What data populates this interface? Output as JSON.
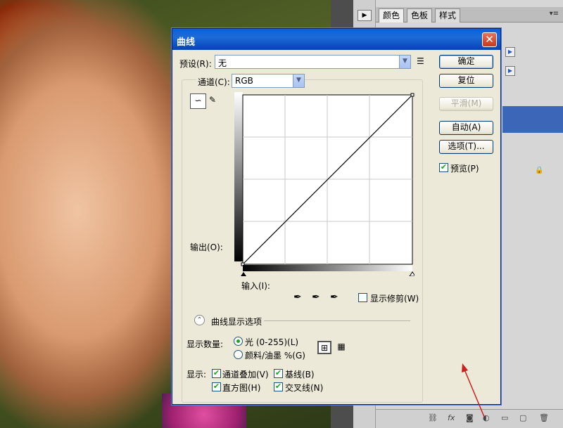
{
  "panel": {
    "tabs": [
      "颜色",
      "色板",
      "样式"
    ],
    "tab_menu_icon": "panel-menu-icon",
    "bottom_icons": [
      "link-icon",
      "fx-icon",
      "mask-icon",
      "adjustment-icon",
      "folder-icon",
      "new-layer-icon",
      "trash-icon"
    ],
    "fx_label": "fx"
  },
  "dialog": {
    "title": "曲线",
    "close_label": "✕",
    "preset_label": "预设(R):",
    "preset_value": "无",
    "channel_label": "通道(C):",
    "channel_value": "RGB",
    "output_label": "输出(O):",
    "input_label": "输入(I):",
    "show_clipping_label": "显示修剪(W)",
    "curve_options_label": "曲线显示选项",
    "show_amount_label": "显示数量:",
    "light_option": "光 (0-255)(L)",
    "pigment_option": "颜料/油墨 %(G)",
    "show_label": "显示:",
    "channel_overlay": "通道叠加(V)",
    "baseline": "基线(B)",
    "histogram": "直方图(H)",
    "intersection": "交叉线(N)",
    "buttons": {
      "ok": "确定",
      "reset": "复位",
      "smooth": "平滑(M)",
      "auto": "自动(A)",
      "options": "选项(T)..."
    },
    "preview_label": "预览(P)",
    "checks": {
      "preview": true,
      "show_clipping": false,
      "channel_overlay": true,
      "baseline": true,
      "histogram": true,
      "intersection": true
    },
    "display_amount_selected": "light"
  },
  "colors": {
    "titlebar": "#0a5fd8",
    "dialog_bg": "#ece9d8",
    "check_mark": "#21a121",
    "arrow": "#cc1f1f"
  }
}
